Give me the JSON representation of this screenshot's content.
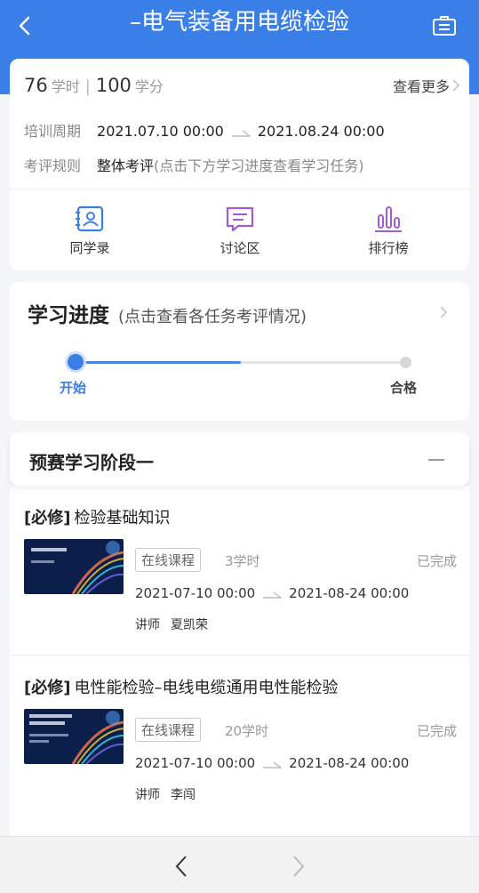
{
  "header": {
    "title": "–电气装备用电缆检验",
    "bg_color": "#3a7ee8"
  },
  "summary": {
    "hours_value": "76",
    "hours_unit": "学时",
    "credits_value": "100",
    "credits_unit": "学分",
    "more_label": "查看更多",
    "period_label": "培训周期",
    "period_start": "2021.07.10 00:00",
    "period_end": "2021.08.24 00:00",
    "rule_label": "考评规则",
    "rule_value": "整体考评",
    "rule_hint": "(点击下方学习进度查看学习任务)"
  },
  "quick_actions": [
    {
      "label": "同学录",
      "icon": "contacts-icon",
      "color": "#3a7ee8"
    },
    {
      "label": "讨论区",
      "icon": "discussion-icon",
      "color": "#a15bd6"
    },
    {
      "label": "排行榜",
      "icon": "ranking-icon",
      "color": "#a15bd6"
    }
  ],
  "progress": {
    "title": "学习进度",
    "hint": "(点击查看各任务考评情况)",
    "start_label": "开始",
    "end_label": "合格",
    "fraction": 0.5
  },
  "stage": {
    "title": "预赛学习阶段一"
  },
  "tasks": [
    {
      "tag": "[必修]",
      "name": "检验基础知识",
      "type": "在线课程",
      "hours": "3学时",
      "status": "已完成",
      "start": "2021-07-10 00:00",
      "end": "2021-08-24 00:00",
      "teacher_label": "讲师",
      "teacher": "夏凯荣"
    },
    {
      "tag": "[必修]",
      "name": "电性能检验–电线电缆通用电性能检验",
      "type": "在线课程",
      "hours": "20学时",
      "status": "已完成",
      "start": "2021-07-10 00:00",
      "end": "2021-08-24 00:00",
      "teacher_label": "讲师",
      "teacher": "李闯"
    }
  ]
}
